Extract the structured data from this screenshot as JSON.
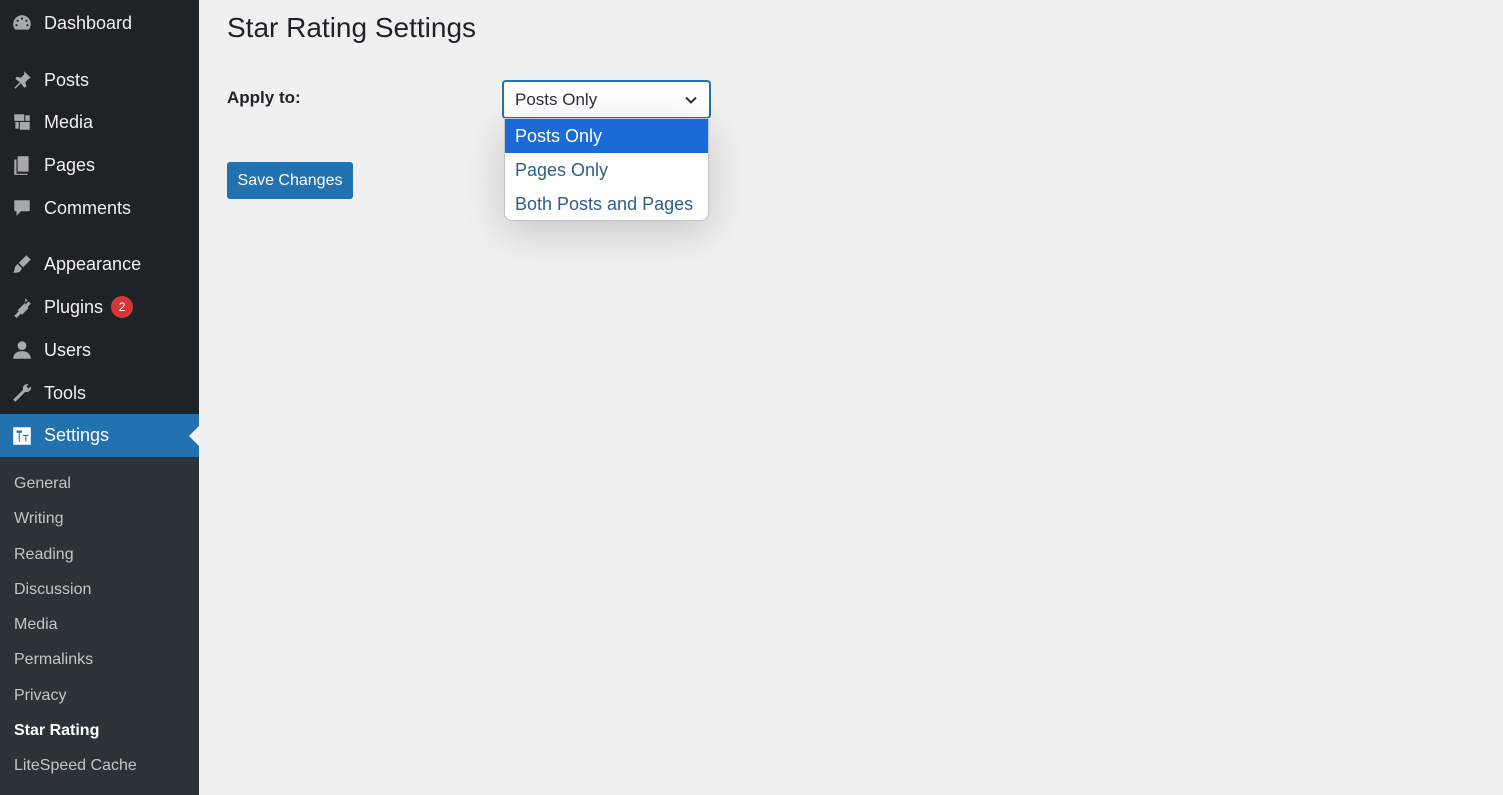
{
  "sidebar": {
    "items": [
      {
        "label": "Dashboard",
        "icon": "dashboard-icon"
      },
      {
        "label": "Posts",
        "icon": "pin-icon"
      },
      {
        "label": "Media",
        "icon": "media-icon"
      },
      {
        "label": "Pages",
        "icon": "pages-icon"
      },
      {
        "label": "Comments",
        "icon": "comment-icon"
      },
      {
        "label": "Appearance",
        "icon": "brush-icon"
      },
      {
        "label": "Plugins",
        "icon": "plug-icon",
        "badge": "2"
      },
      {
        "label": "Users",
        "icon": "user-icon"
      },
      {
        "label": "Tools",
        "icon": "wrench-icon"
      },
      {
        "label": "Settings",
        "icon": "settings-icon"
      }
    ],
    "submenu": [
      {
        "label": "General"
      },
      {
        "label": "Writing"
      },
      {
        "label": "Reading"
      },
      {
        "label": "Discussion"
      },
      {
        "label": "Media"
      },
      {
        "label": "Permalinks"
      },
      {
        "label": "Privacy"
      },
      {
        "label": "Star Rating"
      },
      {
        "label": "LiteSpeed Cache"
      }
    ]
  },
  "main": {
    "title": "Star Rating Settings",
    "apply_label": "Apply to:",
    "select_value": "Posts Only",
    "options": [
      "Posts Only",
      "Pages Only",
      "Both Posts and Pages"
    ],
    "save_label": "Save Changes"
  },
  "colors": {
    "sidebar_bg": "#1d2327",
    "submenu_bg": "#2c3338",
    "accent": "#2271b1",
    "selected_option": "#1a6ad8",
    "badge": "#d63638"
  }
}
